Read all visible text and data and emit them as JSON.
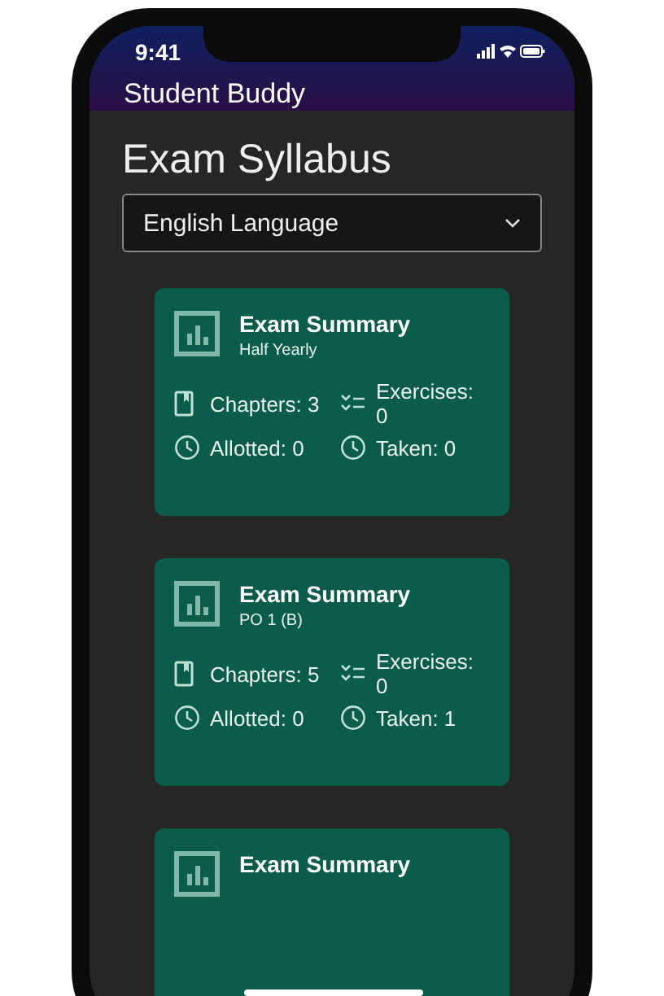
{
  "status_bar": {
    "time": "9:41"
  },
  "app_bar": {
    "title": "Student Buddy"
  },
  "page": {
    "heading": "Exam Syllabus",
    "subject_dropdown": {
      "value": "English Language"
    }
  },
  "cards": [
    {
      "title": "Exam Summary",
      "subtitle": "Half Yearly",
      "chapters": "Chapters: 3",
      "exercises": "Exercises: 0",
      "allotted": "Allotted: 0",
      "taken": "Taken: 0"
    },
    {
      "title": "Exam Summary",
      "subtitle": "PO 1 (B)",
      "chapters": "Chapters: 5",
      "exercises": "Exercises: 0",
      "allotted": "Allotted: 0",
      "taken": "Taken: 1"
    },
    {
      "title": "Exam Summary"
    }
  ]
}
